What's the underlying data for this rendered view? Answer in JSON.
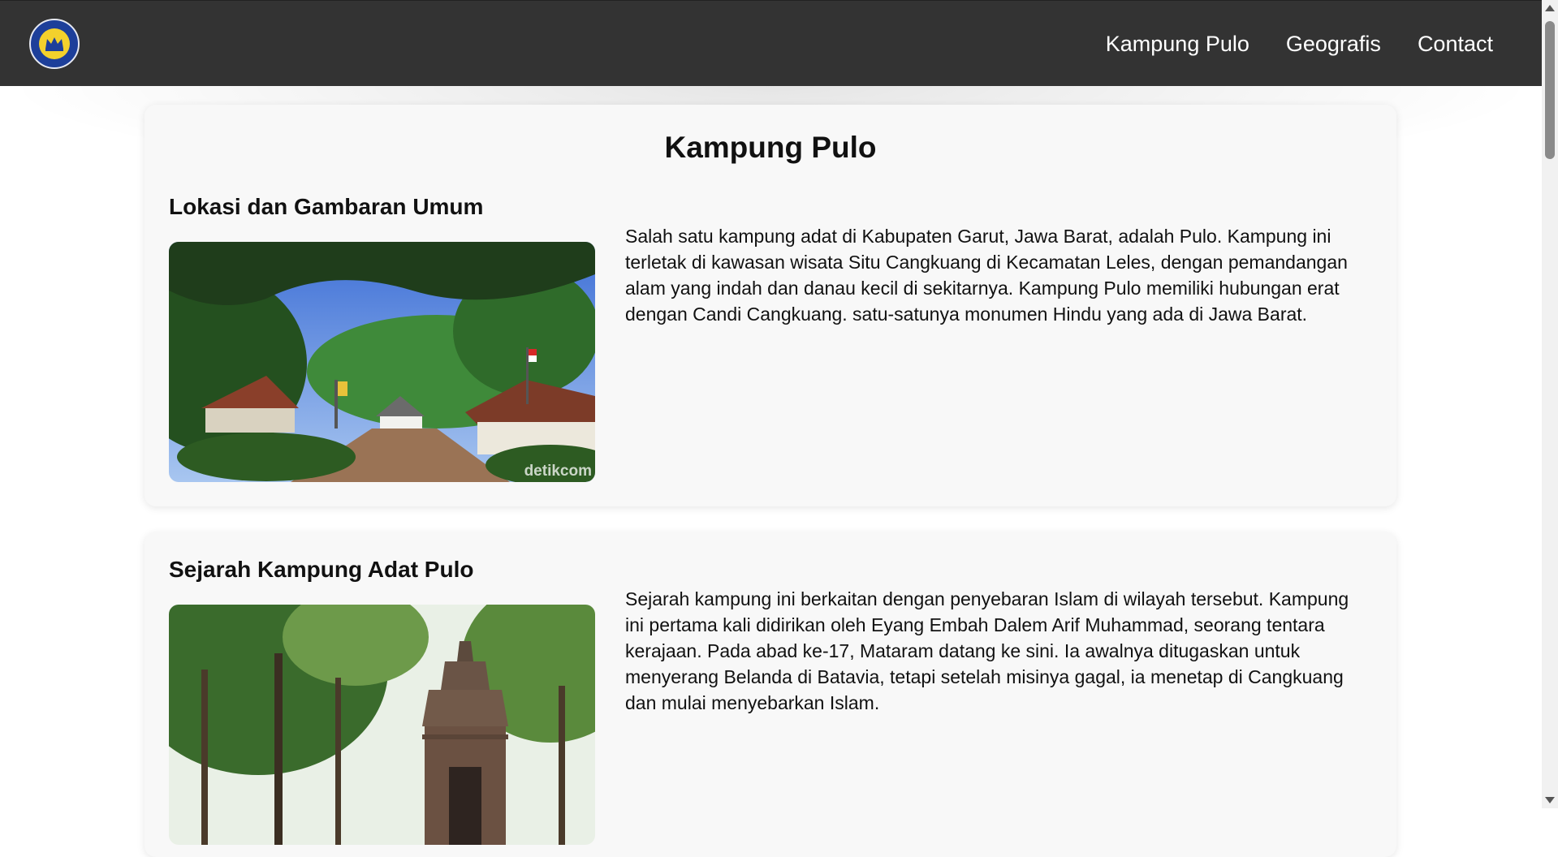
{
  "nav": {
    "logo_icon": "school-logo-icon",
    "links": [
      "Kampung Pulo",
      "Geografis",
      "Contact"
    ]
  },
  "main": {
    "page_title": "Kampung Pulo",
    "sections": [
      {
        "heading": "Lokasi dan Gambaran Umum",
        "image_watermark": "detikcom",
        "paragraph": "Salah satu kampung adat di Kabupaten Garut, Jawa Barat, adalah Pulo. Kampung ini terletak di kawasan wisata Situ Cangkuang di Kecamatan Leles, dengan pemandangan alam yang indah dan danau kecil di sekitarnya. Kampung Pulo memiliki hubungan erat dengan Candi Cangkuang. satu-satunya monumen Hindu yang ada di Jawa Barat."
      },
      {
        "heading": "Sejarah Kampung Adat Pulo",
        "paragraph": "Sejarah kampung ini berkaitan dengan penyebaran Islam di wilayah tersebut. Kampung ini pertama kali didirikan oleh Eyang Embah Dalem Arif Muhammad, seorang tentara kerajaan. Pada abad ke-17, Mataram datang ke sini. Ia awalnya ditugaskan untuk menyerang Belanda di Batavia, tetapi setelah misinya gagal, ia menetap di Cangkuang dan mulai menyebarkan Islam."
      }
    ]
  },
  "colors": {
    "navbar_bg": "#333333",
    "card_bg": "#f8f8f8",
    "nav_text": "#ffffff"
  }
}
